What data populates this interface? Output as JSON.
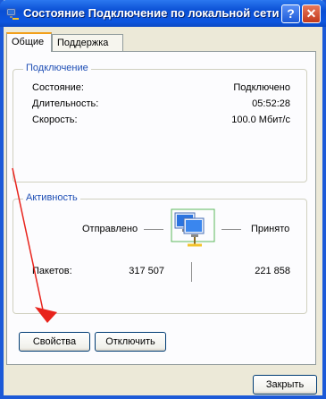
{
  "window": {
    "title": "Состояние Подключение по локальной сети",
    "help_glyph": "?",
    "close_glyph": "✕",
    "icon": "network-connection-icon"
  },
  "tabs": [
    {
      "label": "Общие",
      "active": true
    },
    {
      "label": "Поддержка",
      "active": false
    }
  ],
  "connection": {
    "legend": "Подключение",
    "rows": [
      {
        "label": "Состояние:",
        "value": "Подключено"
      },
      {
        "label": "Длительность:",
        "value": "05:52:28"
      },
      {
        "label": "Скорость:",
        "value": "100.0 Мбит/с"
      }
    ]
  },
  "activity": {
    "legend": "Активность",
    "sent_label": "Отправлено",
    "received_label": "Принято",
    "packets_label": "Пакетов:",
    "sent_value": "317 507",
    "received_value": "221 858",
    "icon": "network-activity-icon"
  },
  "buttons": {
    "properties": "Свойства",
    "disable": "Отключить",
    "close": "Закрыть"
  },
  "annotation": {
    "color": "#e8231c",
    "icon": "red-arrow"
  }
}
